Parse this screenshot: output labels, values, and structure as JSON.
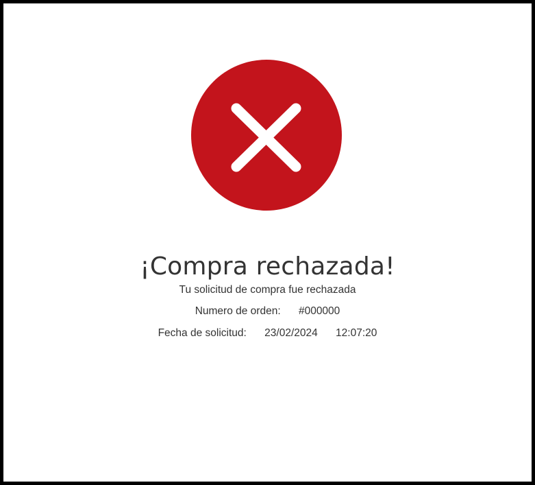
{
  "status": {
    "icon": "close-circle-icon",
    "color": "#c3141c"
  },
  "title": "¡Compra rechazada!",
  "subtitle": "Tu solicitud de compra fue rechazada",
  "order": {
    "label": "Numero de orden:",
    "value": "#000000"
  },
  "request_date": {
    "label": "Fecha de solicitud:",
    "date": "23/02/2024",
    "time": "12:07:20"
  }
}
